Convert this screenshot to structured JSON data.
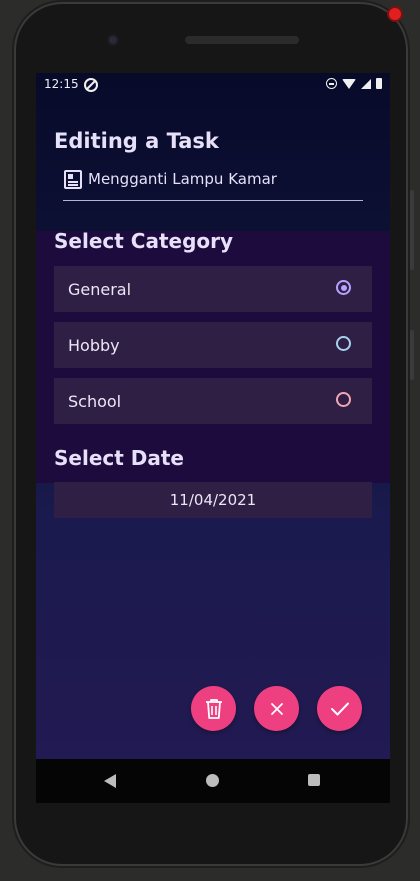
{
  "status_bar": {
    "time": "12:15",
    "left_icon": "data-saver-icon",
    "right_icons": [
      "do-not-disturb-icon",
      "wifi-icon",
      "signal-icon",
      "battery-icon"
    ]
  },
  "header": {
    "title": "Editing a Task",
    "task_icon": "news-article-icon",
    "task_name": "Mengganti Lampu Kamar"
  },
  "category": {
    "heading": "Select Category",
    "options": [
      {
        "label": "General",
        "selected": true,
        "radio_color": "#b7a2ff"
      },
      {
        "label": "Hobby",
        "selected": false,
        "radio_color": "#a9d1ec"
      },
      {
        "label": "School",
        "selected": false,
        "radio_color": "#f2a7b4"
      }
    ]
  },
  "date": {
    "heading": "Select Date",
    "value": "11/04/2021"
  },
  "actions": {
    "delete_icon": "trash-icon",
    "cancel_icon": "close-icon",
    "confirm_icon": "check-icon",
    "accent_color": "#ee3f80"
  },
  "nav_bar": {
    "icons": [
      "back-icon",
      "home-icon",
      "recent-apps-icon"
    ]
  }
}
